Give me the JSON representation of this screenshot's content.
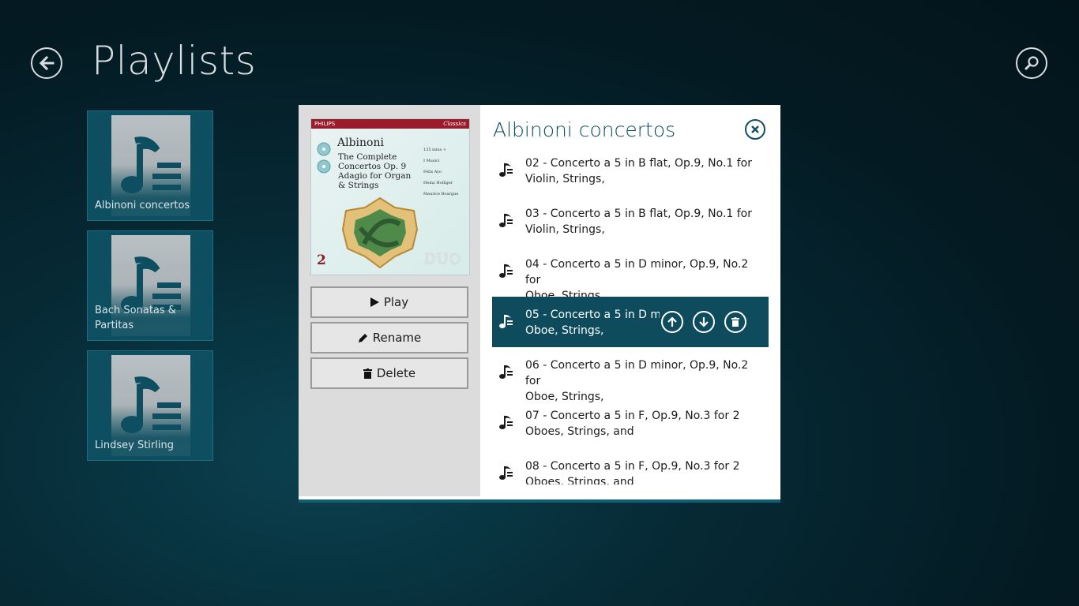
{
  "header": {
    "title": "Playlists",
    "back_icon": "back-arrow-icon",
    "search_icon": "search-icon"
  },
  "playlists": [
    {
      "label": "Albinoni concertos",
      "icon": "music-list-icon"
    },
    {
      "label": "Bach Sonatas & Partitas",
      "icon": "music-list-icon"
    },
    {
      "label": "Lindsey Stirling",
      "icon": "music-list-icon"
    }
  ],
  "dialog": {
    "title": "Albinoni concertos",
    "close_icon": "close-icon",
    "cover": {
      "brand": "PHILIPS",
      "series": "Classics",
      "composer": "Albinoni",
      "subtitle_lines": [
        "The Complete",
        "Concertos Op. 9",
        "Adagio for Organ",
        "& Strings"
      ],
      "credits": [
        "135 mins +",
        "I Musici",
        "Felix Ayo",
        "Heinz Holliger",
        "Maurice Bourgue"
      ],
      "disc_count": "2",
      "edition": "DUO"
    },
    "buttons": {
      "play": "Play",
      "rename": "Rename",
      "delete": "Delete"
    },
    "tracks": [
      {
        "line1": "02 - Concerto a 5 in B flat, Op.9, No.1 for",
        "line2": "Violin, Strings,",
        "selected": false
      },
      {
        "line1": "03 - Concerto a 5 in B flat, Op.9, No.1 for",
        "line2": "Violin, Strings,",
        "selected": false
      },
      {
        "line1": "04 - Concerto a 5 in D minor, Op.9, No.2 for",
        "line2": "Oboe, Strings,",
        "selected": false
      },
      {
        "line1": "05 - Concerto a 5 in D m",
        "line2": "Oboe, Strings,",
        "selected": true
      },
      {
        "line1": "06 - Concerto a 5 in D minor, Op.9, No.2 for",
        "line2": "Oboe, Strings,",
        "selected": false
      },
      {
        "line1": "07 - Concerto a 5 in F, Op.9, No.3 for 2",
        "line2": "Oboes, Strings, and",
        "selected": false
      },
      {
        "line1": "08 - Concerto a 5 in F, Op.9, No.3 for 2",
        "line2": "Oboes, Strings, and",
        "selected": false
      }
    ],
    "row_actions": [
      "move-up-icon",
      "move-down-icon",
      "remove-icon"
    ]
  },
  "colors": {
    "accent": "#0d4b5d",
    "tile": "#0d4f60",
    "title_text": "#d8dde0"
  }
}
